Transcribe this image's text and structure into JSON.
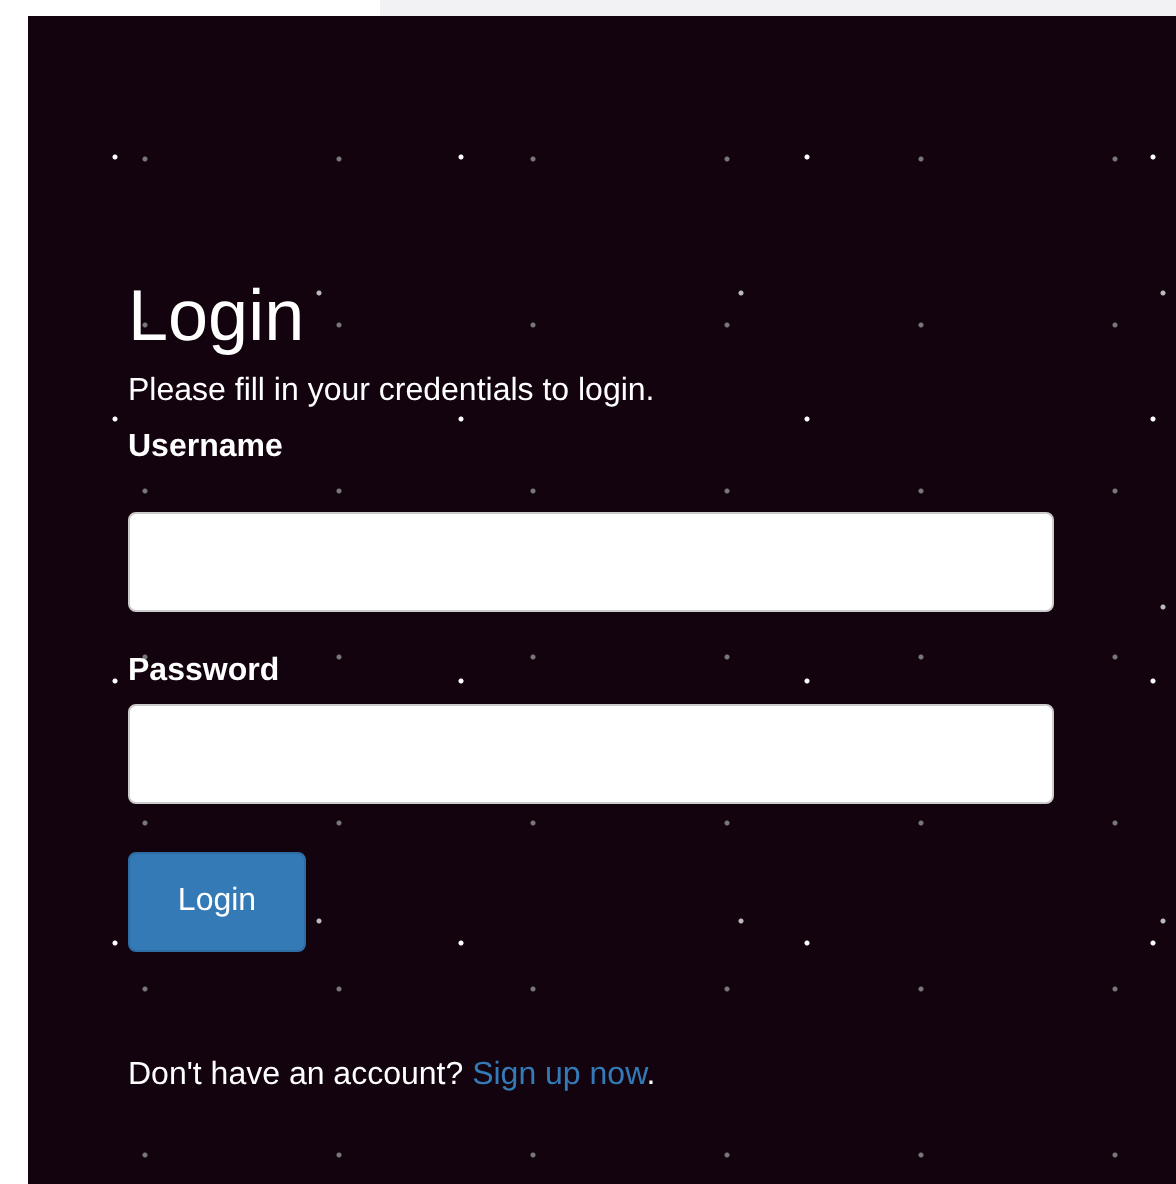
{
  "heading": "Login",
  "subtitle": "Please fill in your credentials to login.",
  "fields": [
    {
      "label": "Username"
    },
    {
      "label": "Password"
    }
  ],
  "submit": "Login",
  "signup": {
    "prompt": "Don't have an account?",
    "link": "Sign up now",
    "suffix": "."
  }
}
